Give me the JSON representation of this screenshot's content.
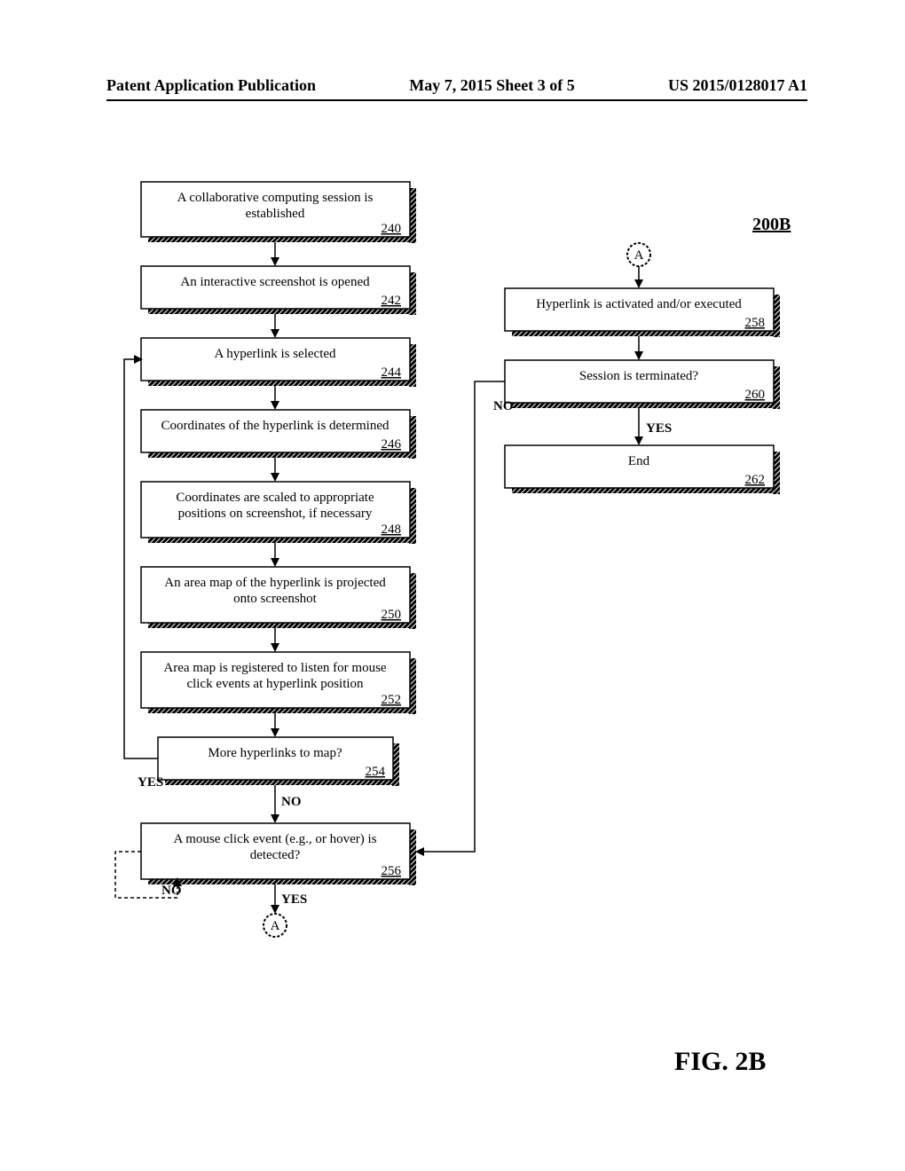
{
  "header": {
    "left": "Patent Application Publication",
    "center": "May 7, 2015   Sheet 3 of 5",
    "right": "US 2015/0128017 A1"
  },
  "figure_ref": "200B",
  "figure_label": "FIG. 2B",
  "connector": "A",
  "edges": {
    "yes": "YES",
    "no": "NO"
  },
  "steps": {
    "s240": {
      "text": "A collaborative computing session is established",
      "num": "240"
    },
    "s242": {
      "text": "An interactive screenshot is opened",
      "num": "242"
    },
    "s244": {
      "text": "A hyperlink is selected",
      "num": "244"
    },
    "s246": {
      "text": "Coordinates of the hyperlink is determined",
      "num": "246"
    },
    "s248": {
      "text_l1": "Coordinates are scaled to appropriate",
      "text_l2": "positions on screenshot, if necessary",
      "num": "248"
    },
    "s250": {
      "text_l1": "An area map of the hyperlink is projected",
      "text_l2": "onto screenshot",
      "num": "250"
    },
    "s252": {
      "text_l1": "Area map is registered to listen for mouse",
      "text_l2": "click events at hyperlink position",
      "num": "252"
    },
    "s254": {
      "text": "More hyperlinks to map?",
      "num": "254"
    },
    "s256": {
      "text_l1": "A mouse click event (e.g., or hover) is",
      "text_l2": "detected?",
      "num": "256"
    },
    "s258": {
      "text": "Hyperlink is activated and/or executed",
      "num": "258"
    },
    "s260": {
      "text": "Session is terminated?",
      "num": "260"
    },
    "s262": {
      "text": "End",
      "num": "262"
    }
  }
}
